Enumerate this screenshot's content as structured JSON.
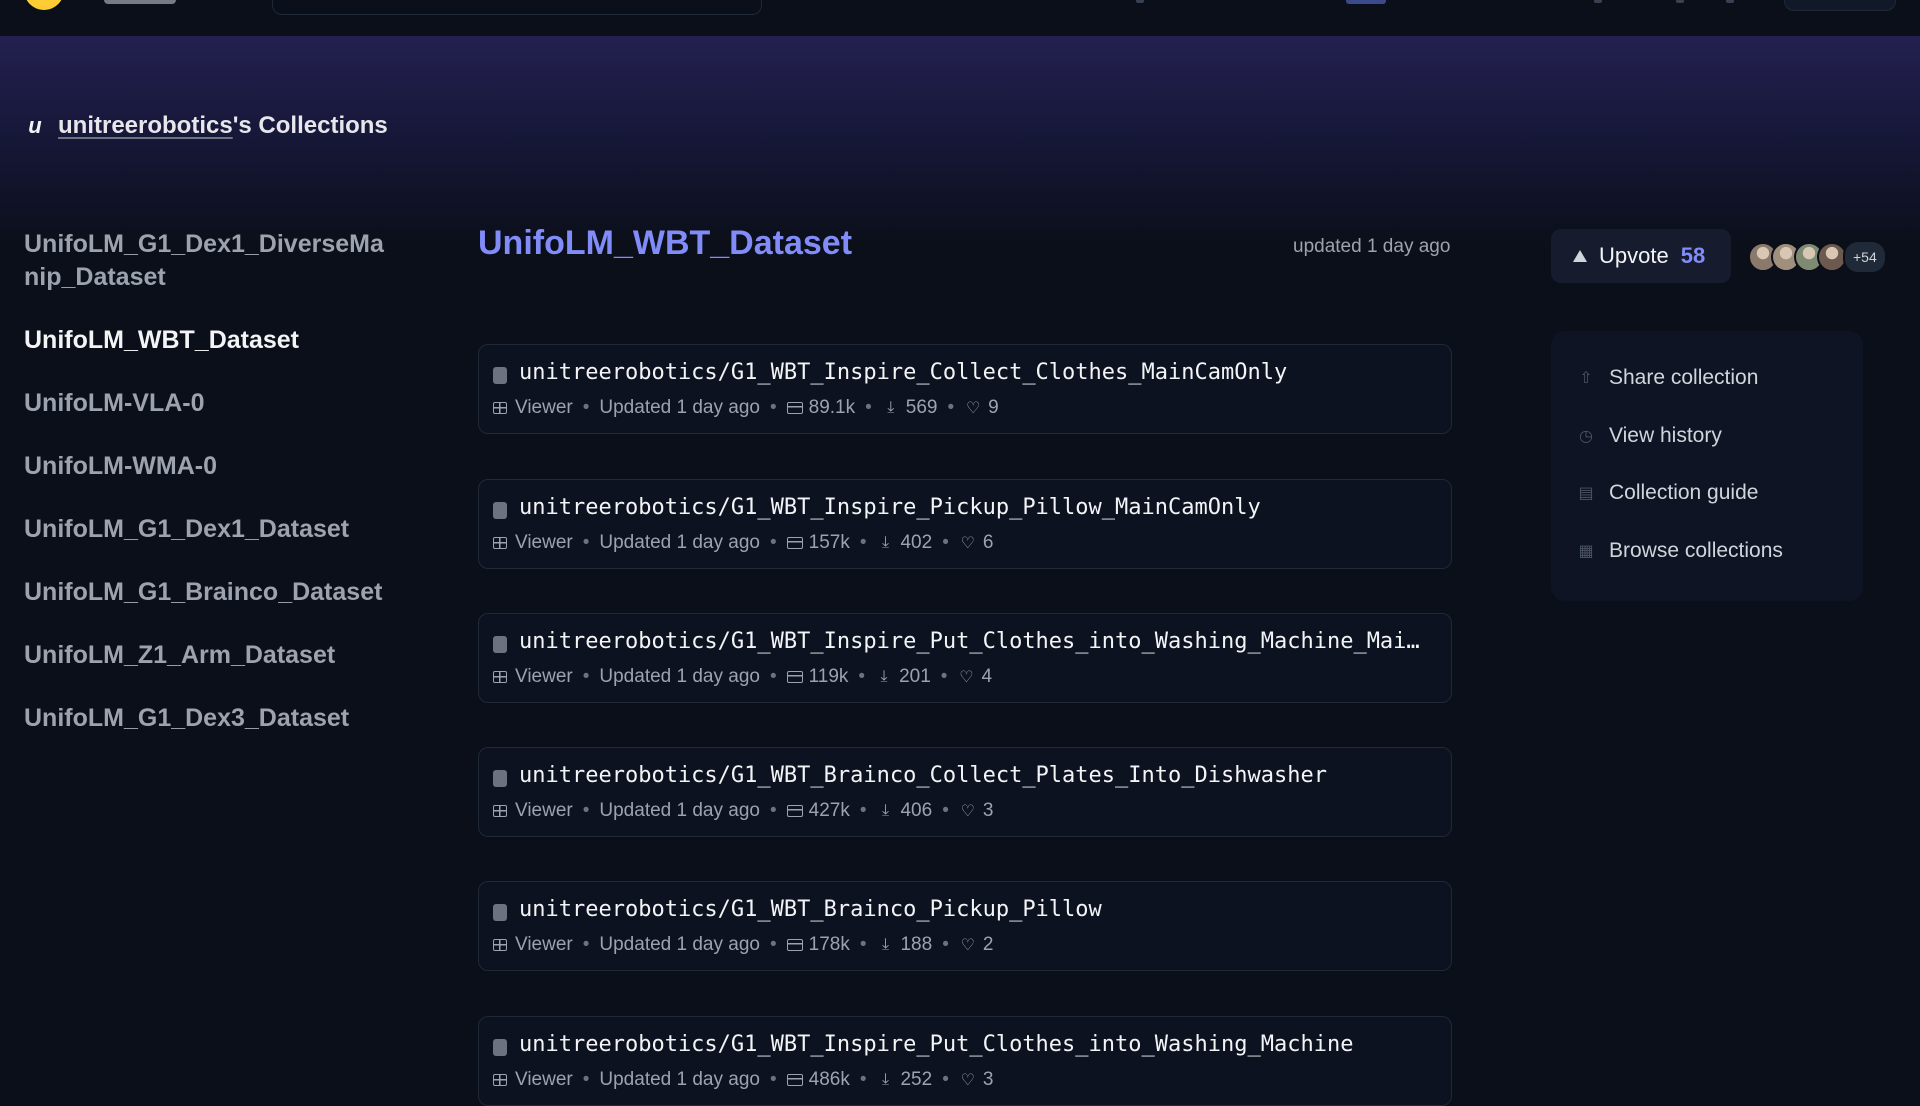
{
  "org": {
    "name": "unitreerobotics",
    "suffix": "'s Collections",
    "avatar_letter": "u"
  },
  "sidebar": {
    "items": [
      {
        "label": "UnifoLM_G1_Dex1_DiverseMa nip_Dataset",
        "active": false
      },
      {
        "label": "UnifoLM_WBT_Dataset",
        "active": true
      },
      {
        "label": "UnifoLM-VLA-0",
        "active": false
      },
      {
        "label": "UnifoLM-WMA-0",
        "active": false
      },
      {
        "label": "UnifoLM_G1_Dex1_Dataset",
        "active": false
      },
      {
        "label": "UnifoLM_G1_Brainco_Dataset",
        "active": false
      },
      {
        "label": "UnifoLM_Z1_Arm_Dataset",
        "active": false
      },
      {
        "label": "UnifoLM_G1_Dex3_Dataset",
        "active": false
      }
    ]
  },
  "collection": {
    "title": "UnifoLM_WBT_Dataset",
    "updated": "updated 1 day ago"
  },
  "upvote": {
    "label": "Upvote",
    "count": "58"
  },
  "upvoters": {
    "more": "+54",
    "colors": [
      "#8b7a6b",
      "#a08f7d",
      "#7f8a72",
      "#6d5a4e"
    ]
  },
  "actions": [
    {
      "label": "Share collection",
      "icon": "share-icon"
    },
    {
      "label": "View history",
      "icon": "history-icon"
    },
    {
      "label": "Collection guide",
      "icon": "book-icon"
    },
    {
      "label": "Browse collections",
      "icon": "grid-icon"
    }
  ],
  "datasets": [
    {
      "title": "unitreerobotics/G1_WBT_Inspire_Collect_Clothes_MainCamOnly",
      "viewer": "Viewer",
      "updated": "Updated 1 day ago",
      "rows": "89.1k",
      "downloads": "569",
      "likes": "9"
    },
    {
      "title": "unitreerobotics/G1_WBT_Inspire_Pickup_Pillow_MainCamOnly",
      "viewer": "Viewer",
      "updated": "Updated 1 day ago",
      "rows": "157k",
      "downloads": "402",
      "likes": "6"
    },
    {
      "title": "unitreerobotics/G1_WBT_Inspire_Put_Clothes_into_Washing_Machine_Mai…",
      "viewer": "Viewer",
      "updated": "Updated 1 day ago",
      "rows": "119k",
      "downloads": "201",
      "likes": "4"
    },
    {
      "title": "unitreerobotics/G1_WBT_Brainco_Collect_Plates_Into_Dishwasher",
      "viewer": "Viewer",
      "updated": "Updated 1 day ago",
      "rows": "427k",
      "downloads": "406",
      "likes": "3"
    },
    {
      "title": "unitreerobotics/G1_WBT_Brainco_Pickup_Pillow",
      "viewer": "Viewer",
      "updated": "Updated 1 day ago",
      "rows": "178k",
      "downloads": "188",
      "likes": "2"
    },
    {
      "title": "unitreerobotics/G1_WBT_Inspire_Put_Clothes_into_Washing_Machine",
      "viewer": "Viewer",
      "updated": "Updated 1 day ago",
      "rows": "486k",
      "downloads": "252",
      "likes": "3"
    }
  ]
}
